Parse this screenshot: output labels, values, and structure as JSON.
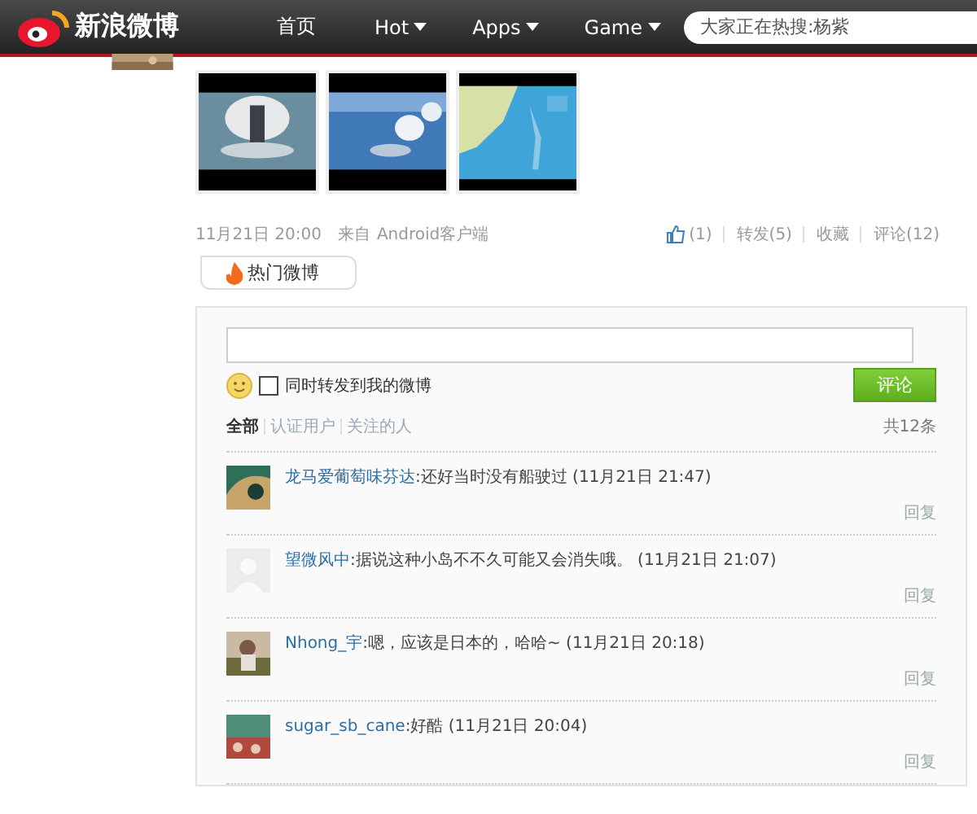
{
  "header": {
    "logo": "新浪微博",
    "nav": [
      {
        "label": "首页",
        "dropdown": false
      },
      {
        "label": "Hot",
        "dropdown": true
      },
      {
        "label": "Apps",
        "dropdown": true
      },
      {
        "label": "Game",
        "dropdown": true
      }
    ],
    "search": {
      "placeholder": "大家正在热搜:杨紫"
    }
  },
  "post": {
    "time": "11月21日 20:00",
    "source_prefix": "来自",
    "source": "Android客户端",
    "actions": [
      "(1)",
      "转发(5)",
      "收藏",
      "评论(12)"
    ],
    "hot_tag": "热门微博"
  },
  "comments_panel": {
    "repost_label": "同时转发到我的微博",
    "repost_checked": false,
    "submit": "评论",
    "filters": [
      {
        "label": "全部",
        "selected": true
      },
      {
        "label": "认证用户",
        "selected": false
      },
      {
        "label": "关注的人",
        "selected": false
      }
    ],
    "total": "共12条",
    "comments": [
      {
        "user": "龙马爱葡萄味芬达",
        "text": ":还好当时没有船驶过",
        "time": "(11月21日 21:47)",
        "reply": "回复"
      },
      {
        "user": "望微风中",
        "text": ":据说这种小岛不不久可能又会消失哦。",
        "time": "(11月21日 21:07)",
        "reply": "回复",
        "avatar": {
          "kind": "default"
        }
      },
      {
        "user": "Nhong_宇",
        "text": ":嗯，应该是日本的，哈哈~",
        "time": "(11月21日 20:18)",
        "reply": "回复"
      },
      {
        "user": "sugar_sb_cane",
        "text": ":好酷",
        "time": "(11月21日 20:04)",
        "reply": "回复"
      }
    ]
  }
}
